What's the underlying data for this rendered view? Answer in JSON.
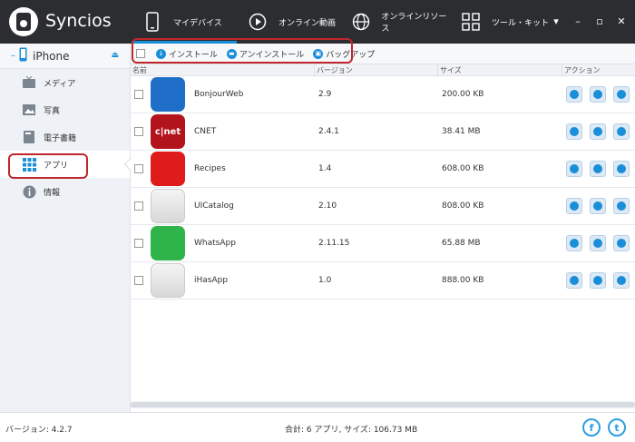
{
  "app": {
    "title": "Syncios",
    "accent": "#1a8ed8",
    "highlight": "#c0262c"
  },
  "topnav": [
    {
      "label": "マイデバイス",
      "icon": "phone-icon"
    },
    {
      "label": "オンライン動画",
      "icon": "play-icon"
    },
    {
      "label": "オンラインリソース",
      "icon": "globe-icon"
    },
    {
      "label": "ツール・キット",
      "icon": "grid-icon"
    }
  ],
  "sidebar": {
    "device": "iPhone",
    "items": [
      {
        "label": "メディア",
        "icon": "tv-icon"
      },
      {
        "label": "写真",
        "icon": "photo-icon"
      },
      {
        "label": "電子書籍",
        "icon": "book-icon"
      },
      {
        "label": "アプリ",
        "icon": "apps-grid-icon"
      },
      {
        "label": "情報",
        "icon": "info-icon"
      }
    ]
  },
  "toolbar": {
    "install": "インストール",
    "uninstall": "アンインストール",
    "backup": "バッグアップ"
  },
  "table": {
    "headers": {
      "name": "名前",
      "version": "バージョン",
      "size": "サイズ",
      "action": "アクション"
    },
    "rows": [
      {
        "name": "BonjourWeb",
        "version": "2.9",
        "size": "200.00 KB",
        "icon_color": "#1f6fc9",
        "icon_text": ""
      },
      {
        "name": "CNET",
        "version": "2.4.1",
        "size": "38.41 MB",
        "icon_color": "#b3141c",
        "icon_text": "c|net"
      },
      {
        "name": "Recipes",
        "version": "1.4",
        "size": "608.00 KB",
        "icon_color": "#e01b1b",
        "icon_text": ""
      },
      {
        "name": "UICatalog",
        "version": "2.10",
        "size": "808.00 KB",
        "icon_color": "#e4e4e4",
        "icon_text": ""
      },
      {
        "name": "WhatsApp",
        "version": "2.11.15",
        "size": "65.88 MB",
        "icon_color": "#2fb44a",
        "icon_text": ""
      },
      {
        "name": "iHasApp",
        "version": "1.0",
        "size": "888.00 KB",
        "icon_color": "#e4e4e4",
        "icon_text": ""
      }
    ]
  },
  "status": {
    "version": "バージョン: 4.2.7",
    "summary": "合計: 6 アプリ, サイズ: 106.73 MB",
    "facebook": "f",
    "twitter": "t"
  }
}
